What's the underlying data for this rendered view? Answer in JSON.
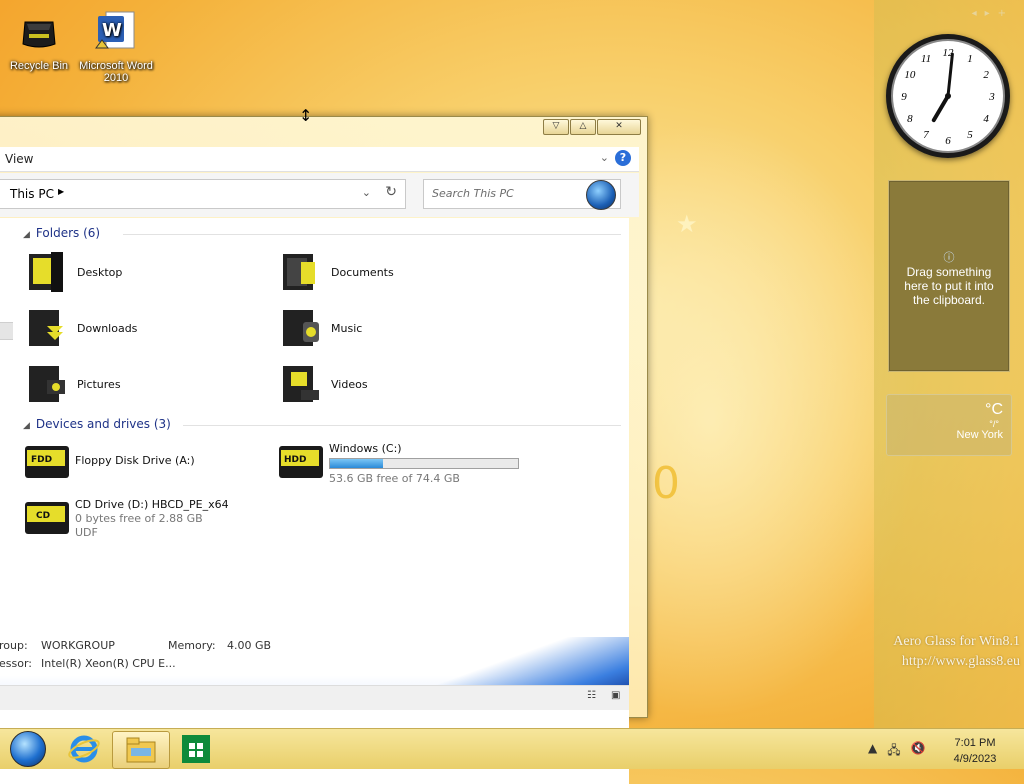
{
  "desktop": {
    "icons": [
      {
        "label": "Recycle Bin"
      },
      {
        "label": "Microsoft Word 2010"
      }
    ]
  },
  "explorer": {
    "menu": {
      "view_label": "View"
    },
    "address": {
      "location": "This PC"
    },
    "search": {
      "placeholder": "Search This PC"
    },
    "folders_group": {
      "title": "Folders (6)"
    },
    "folders": [
      {
        "label": "Desktop"
      },
      {
        "label": "Documents"
      },
      {
        "label": "Downloads"
      },
      {
        "label": "Music"
      },
      {
        "label": "Pictures"
      },
      {
        "label": "Videos"
      }
    ],
    "drives_group": {
      "title": "Devices and drives (3)"
    },
    "drives": {
      "floppy": {
        "name": "Floppy Disk Drive (A:)",
        "badge": "FDD"
      },
      "windows": {
        "name": "Windows (C:)",
        "free": "53.6 GB free of 74.4 GB",
        "used_fraction": 0.28,
        "badge": "HDD"
      },
      "cd": {
        "name": "CD Drive (D:) HBCD_PE_x64",
        "free": "0 bytes free of 2.88 GB",
        "fs": "UDF",
        "badge": "CD"
      }
    },
    "details": {
      "workgroup_key": "roup:",
      "workgroup_val": "WORKGROUP",
      "memory_key": "Memory:",
      "memory_val": "4.00 GB",
      "processor_key": "essor:",
      "processor_val": "Intel(R) Xeon(R) CPU E..."
    }
  },
  "gadgets": {
    "clock": {
      "hour": 7,
      "minute": 1
    },
    "clipboard": {
      "text": "Drag something here to put it into the clipboard."
    },
    "weather": {
      "unit": "°C",
      "range": "°/°",
      "city": "New York"
    }
  },
  "watermark": {
    "line1": "Aero Glass for Win8.1",
    "line2": "http://www.glass8.eu"
  },
  "taskbar": {
    "time": "7:01 PM",
    "date": "4/9/2023"
  },
  "colors": {
    "accent": "#1e3287",
    "help_blue": "#2a6ed8",
    "drive_yellow": "#e6dd2a"
  }
}
